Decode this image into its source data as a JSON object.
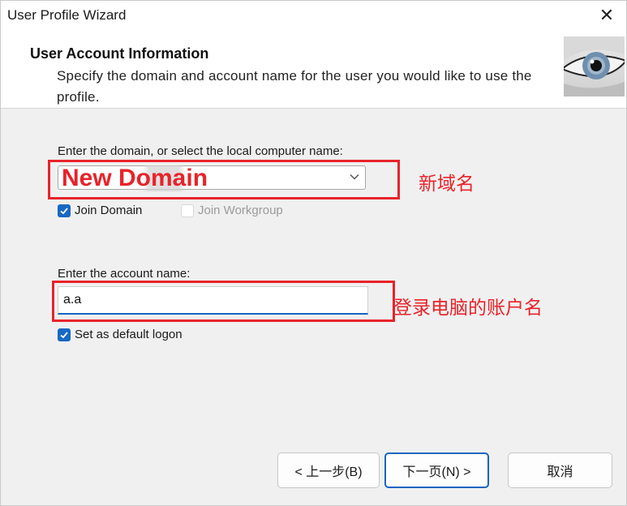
{
  "window": {
    "title": "User Profile Wizard",
    "close_glyph": "✕"
  },
  "header": {
    "title": "User Account Information",
    "description": "Specify the domain and account name for the user you would like to use the profile."
  },
  "domain": {
    "label": "Enter the domain, or select the local computer name:",
    "value": "New Domain"
  },
  "checkboxes": {
    "join_domain": {
      "label": "Join Domain",
      "checked": true
    },
    "join_workgroup": {
      "label": "Join Workgroup",
      "checked": false,
      "enabled": false
    }
  },
  "account": {
    "label": "Enter the account name:",
    "value": "a.a"
  },
  "default_logon": {
    "label": "Set as default logon",
    "checked": true
  },
  "annotations": {
    "domain_note": "新域名",
    "account_note": "登录电脑的账户名"
  },
  "buttons": {
    "back": "< 上一步(B)",
    "next": "下一页(N) >",
    "cancel": "取消"
  },
  "colors": {
    "accent": "#1868c4",
    "annotation_red": "#e8232a"
  }
}
